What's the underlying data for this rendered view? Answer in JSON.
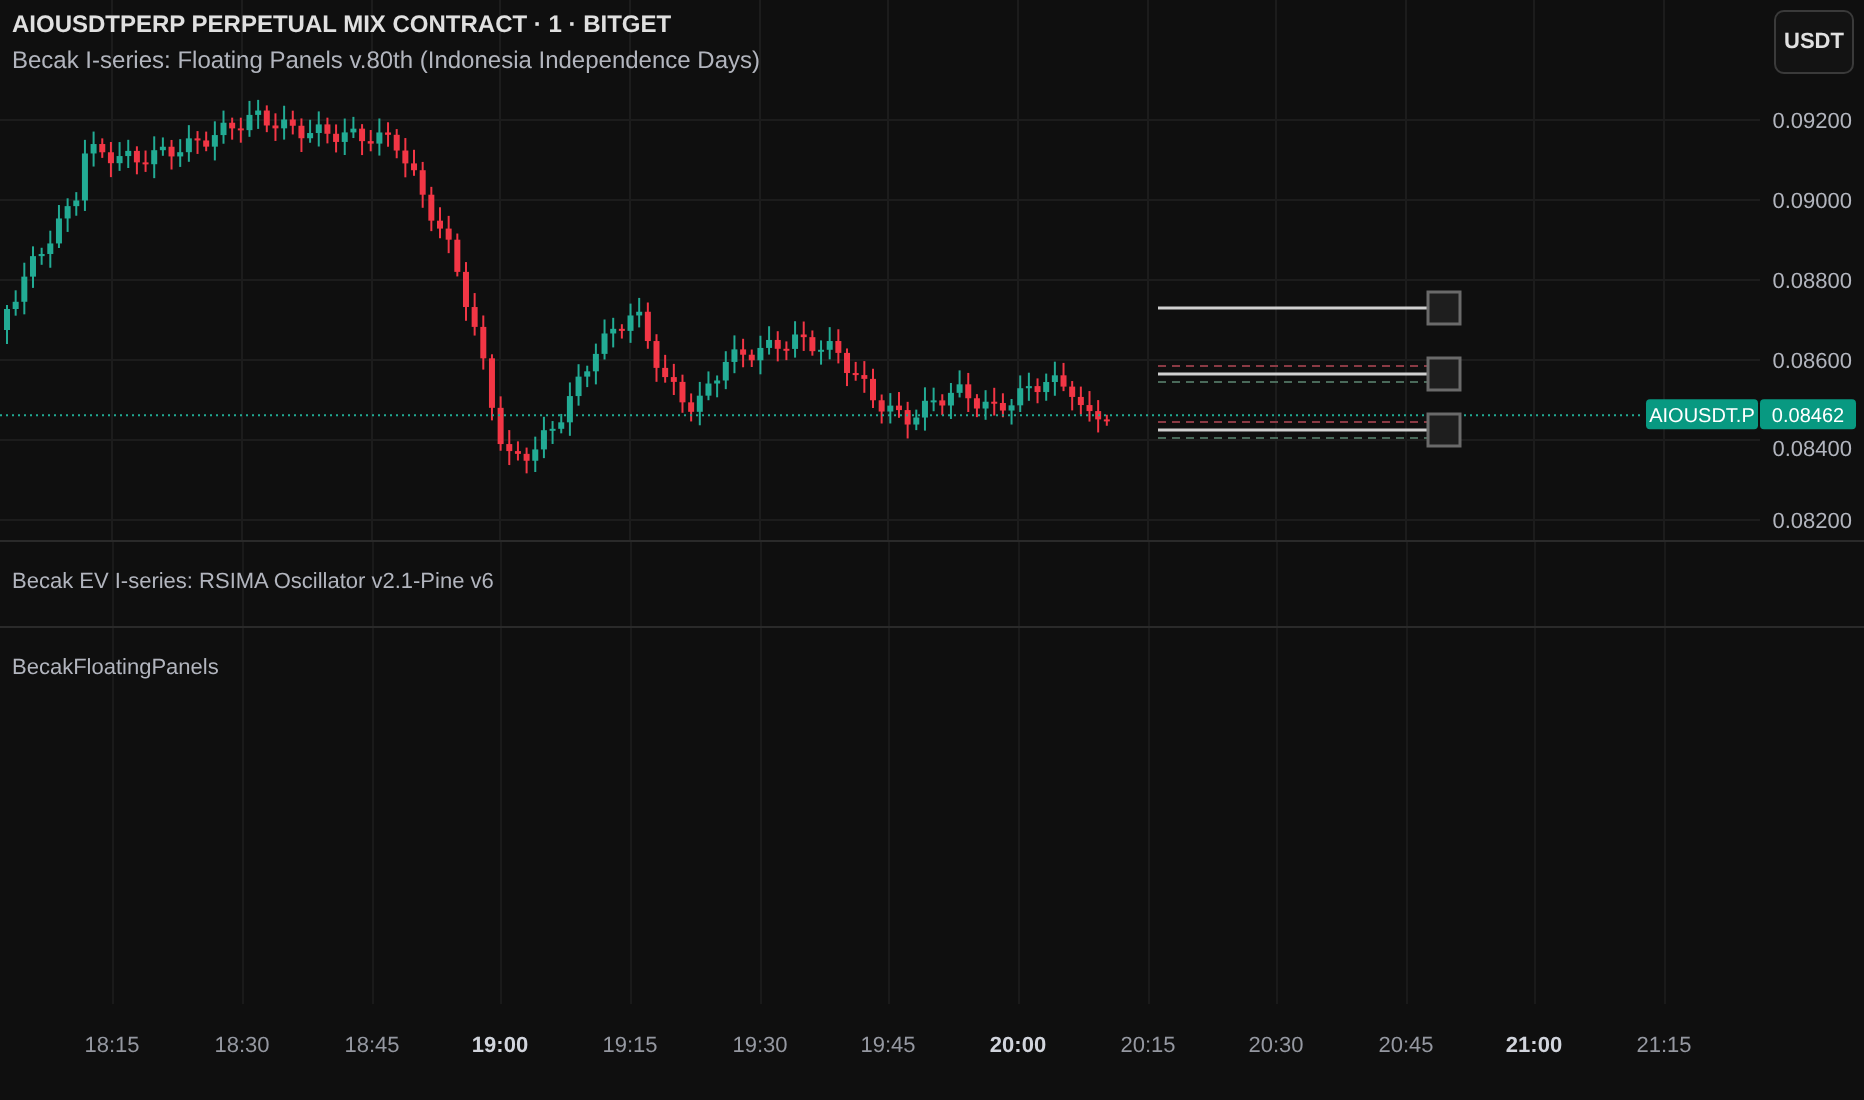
{
  "header": {
    "symbol_title": "AIOUSDTPERP PERPETUAL MIX CONTRACT · 1 · BITGET",
    "indicator": "Becak I-series: Floating Panels v.80th (Indonesia Independence Days)",
    "currency_button": "USDT"
  },
  "price_axis": [
    "0.09200",
    "0.09000",
    "0.08800",
    "0.08600",
    "0.08400",
    "0.08200"
  ],
  "last_price": {
    "symbol": "AIOUSDT.P",
    "price": "0.08462"
  },
  "panes": [
    {
      "title": "Becak EV I-series: RSIMA Oscillator v2.1-Pine v6"
    },
    {
      "title": "BecakFloatingPanels"
    }
  ],
  "time_axis": [
    {
      "label": "18:15",
      "major": false
    },
    {
      "label": "18:30",
      "major": false
    },
    {
      "label": "18:45",
      "major": false
    },
    {
      "label": "19:00",
      "major": true
    },
    {
      "label": "19:15",
      "major": false
    },
    {
      "label": "19:30",
      "major": false
    },
    {
      "label": "19:45",
      "major": false
    },
    {
      "label": "20:00",
      "major": true
    },
    {
      "label": "20:15",
      "major": false
    },
    {
      "label": "20:30",
      "major": false
    },
    {
      "label": "20:45",
      "major": false
    },
    {
      "label": "21:00",
      "major": true
    },
    {
      "label": "21:15",
      "major": false
    }
  ]
}
